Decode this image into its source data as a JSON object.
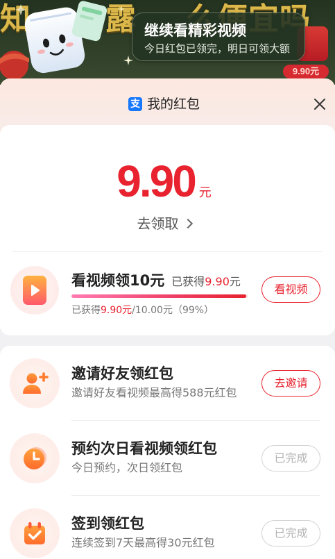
{
  "banner": {
    "bg_text": {
      "left": "知",
      "mid": "露",
      "right": "么便宜吗"
    },
    "title": "继续看精彩视频",
    "subtitle": "今日红包已领完，明日可领大额",
    "corner_amount": "9.90元"
  },
  "header": {
    "app_badge": "支",
    "title": "我的红包",
    "close_icon": "close-icon"
  },
  "balance": {
    "amount": "9.90",
    "unit": "元",
    "claim_label": "去领取",
    "claim_icon": "chevron-right-icon"
  },
  "video_task": {
    "icon": "play-icon",
    "title": "看视频领10元",
    "earned": {
      "prefix": "已获得",
      "amount": "9.90",
      "unit": "元"
    },
    "progress": 0.99,
    "progress_text": {
      "prefix": "已获得",
      "amount": "9.90元",
      "suffix": "/10.00元（99%）"
    },
    "button": "看视频"
  },
  "tasks": [
    {
      "icon": "person-add-icon",
      "title": "邀请好友领红包",
      "subtitle": "邀请好友看视频最高得588元红包",
      "button": "去邀请",
      "done": false
    },
    {
      "icon": "clock-icon",
      "title": "预约次日看视频领红包",
      "subtitle": "今日预约，次日领红包",
      "button": "已完成",
      "done": true
    },
    {
      "icon": "calendar-check-icon",
      "title": "签到领红包",
      "subtitle": "连续签到7天最高得30元红包",
      "button": "已完成",
      "done": true
    }
  ],
  "colors": {
    "accent_red": "#e8222e",
    "done_gray": "#b3b3b3",
    "icon_orange": "#ff7a2c",
    "banner_bg": "#2f3f28",
    "app_badge_blue": "#1677ff"
  }
}
